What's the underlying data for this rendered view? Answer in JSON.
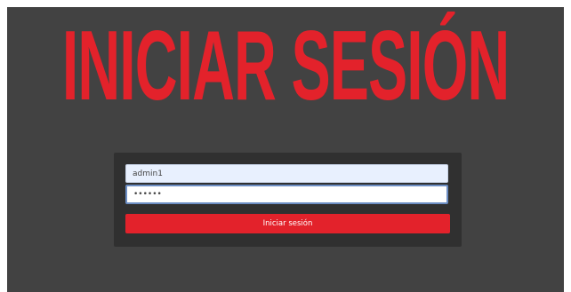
{
  "header": {
    "title": "INICIAR SESIÓN"
  },
  "login_form": {
    "username": {
      "value": "admin1"
    },
    "password": {
      "value": "••••••"
    },
    "submit_label": "Iniciar sesión"
  },
  "colors": {
    "background": "#424242",
    "card": "#303030",
    "accent": "#e3222b"
  }
}
